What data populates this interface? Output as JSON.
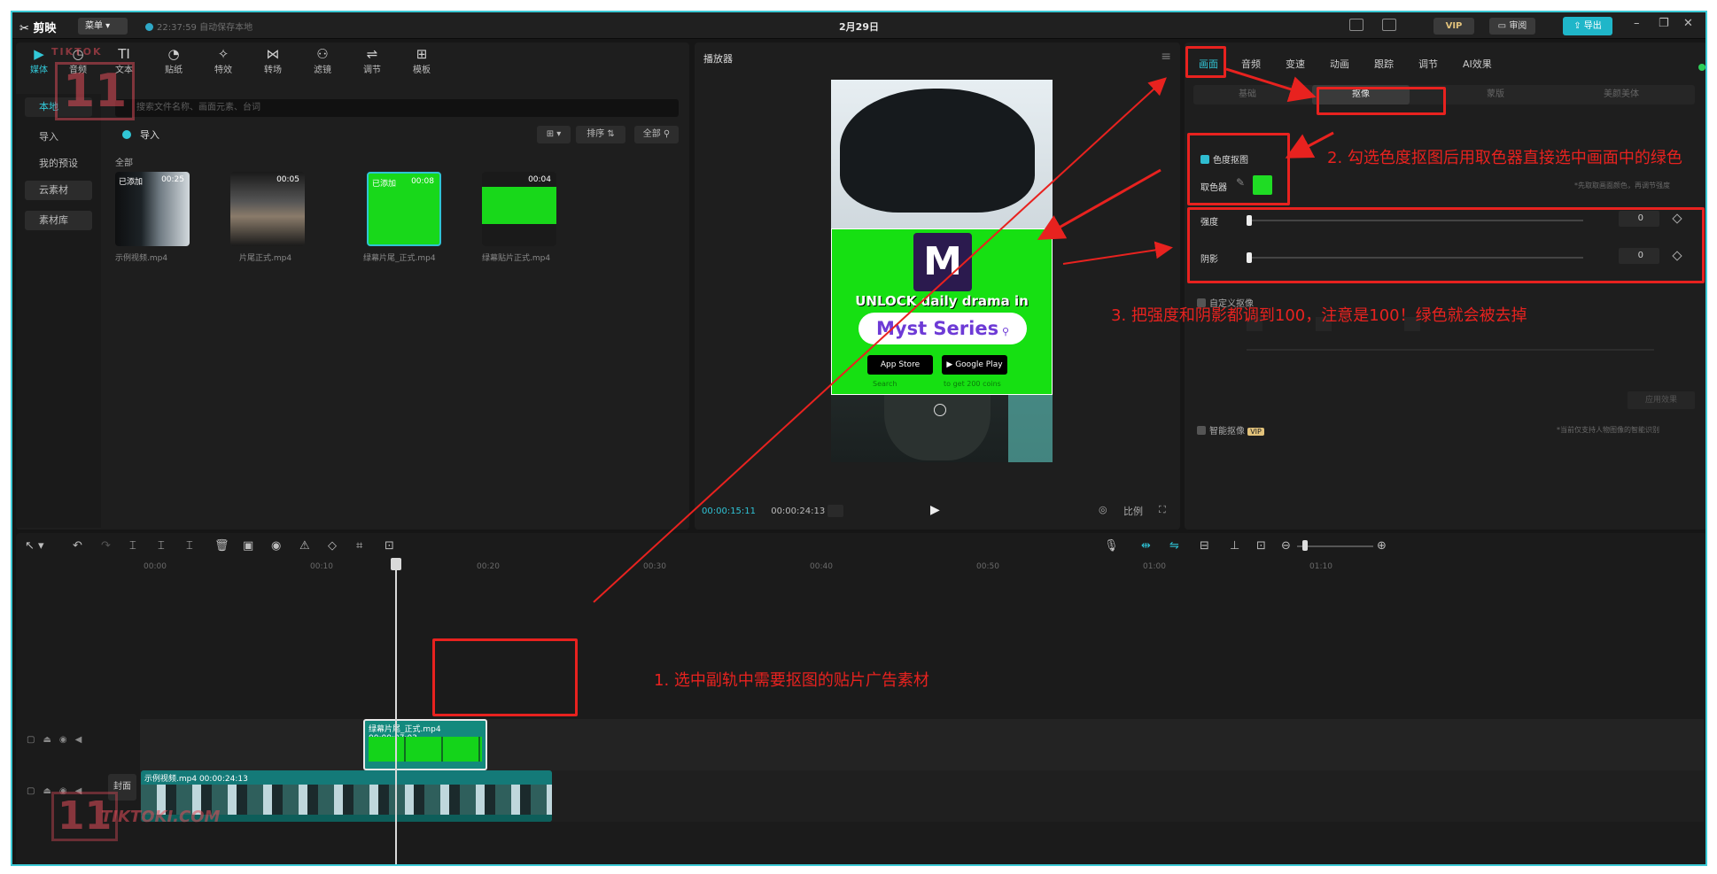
{
  "app": {
    "menu_label": "菜单",
    "save_status": "22:37:59 自动保存本地",
    "project_title": "2月29日",
    "vip_label": "VIP",
    "share_label": "审阅",
    "export_label": "导出"
  },
  "media_tools": [
    {
      "label": "媒体",
      "icon": "media-icon"
    },
    {
      "label": "音频",
      "icon": "audio-icon"
    },
    {
      "label": "文本",
      "icon": "text-icon"
    },
    {
      "label": "贴纸",
      "icon": "sticker-icon"
    },
    {
      "label": "特效",
      "icon": "effects-icon"
    },
    {
      "label": "转场",
      "icon": "transition-icon"
    },
    {
      "label": "滤镜",
      "icon": "filter-icon"
    },
    {
      "label": "调节",
      "icon": "adjust-icon"
    },
    {
      "label": "模板",
      "icon": "template-icon"
    }
  ],
  "media_side": {
    "local": "本地",
    "import": "导入",
    "my_presets": "我的预设",
    "cloud": "云素材",
    "library": "素材库"
  },
  "media": {
    "search_placeholder": "搜索文件名称、画面元素、台词",
    "import_label": "导入",
    "sort_label": "排序",
    "filter_label": "全部",
    "all_label": "全部",
    "items": [
      {
        "badge": "已添加",
        "duration": "00:25",
        "name": "示例视频.mp4"
      },
      {
        "badge": "",
        "duration": "00:05",
        "name": "片尾正式.mp4"
      },
      {
        "badge": "已添加",
        "duration": "00:08",
        "name": "绿幕片尾_正式.mp4"
      },
      {
        "badge": "",
        "duration": "00:04",
        "name": "绿幕贴片正式.mp4"
      }
    ]
  },
  "player": {
    "title": "播放器",
    "current_time": "00:00:15:11",
    "total_time": "00:00:24:13",
    "ratio_label": "比例",
    "ad": {
      "logo": "M",
      "headline": "UNLOCK daily drama in",
      "brand": "Myst Series",
      "app_store": "App Store",
      "google_play": "Google Play",
      "search_hint": "Search",
      "get_hint": "to get 200 coins"
    }
  },
  "inspector": {
    "tabs": [
      "画面",
      "音频",
      "变速",
      "动画",
      "跟踪",
      "调节",
      "AI效果"
    ],
    "subtabs": [
      "基础",
      "抠像",
      "蒙版",
      "美颜美体"
    ],
    "chroma_key_label": "色度抠图",
    "picker_label": "取色器",
    "picker_hint": "*先取取画面颜色，再调节强度",
    "intensity_label": "强度",
    "intensity_value": "0",
    "shadow_label": "阴影",
    "shadow_value": "0",
    "custom_matting_label": "自定义抠像",
    "apply_label": "应用效果",
    "smart_matting_label": "智能抠像",
    "smart_vip": "VIP",
    "smart_hint": "*当前仅支持人物图像的智能识别",
    "accent_color": "#32c8d8",
    "picked_color": "#1fdc24"
  },
  "timeline": {
    "ticks": [
      "00:00",
      "00:10",
      "00:20",
      "00:30",
      "00:40",
      "00:50",
      "01:00",
      "01:10"
    ],
    "cover_label": "封面",
    "clip_ad": {
      "name": "绿幕片尾_正式.mp4",
      "duration": "00:00:07:03"
    },
    "clip_main": {
      "name": "示例视频.mp4",
      "duration": "00:00:24:13"
    }
  },
  "annotations": {
    "step1": "1. 选中副轨中需要抠图的贴片广告素材",
    "step2": "2. 勾选色度抠图后用取色器直接选中画面中的绿色",
    "step3": "3. 把强度和阴影都调到100，注意是100！绿色就会被去掉",
    "color": "#e8221f"
  },
  "watermark": {
    "brand": "TIKTOK",
    "number": "11",
    "site": "TIKTOKI.COM"
  }
}
